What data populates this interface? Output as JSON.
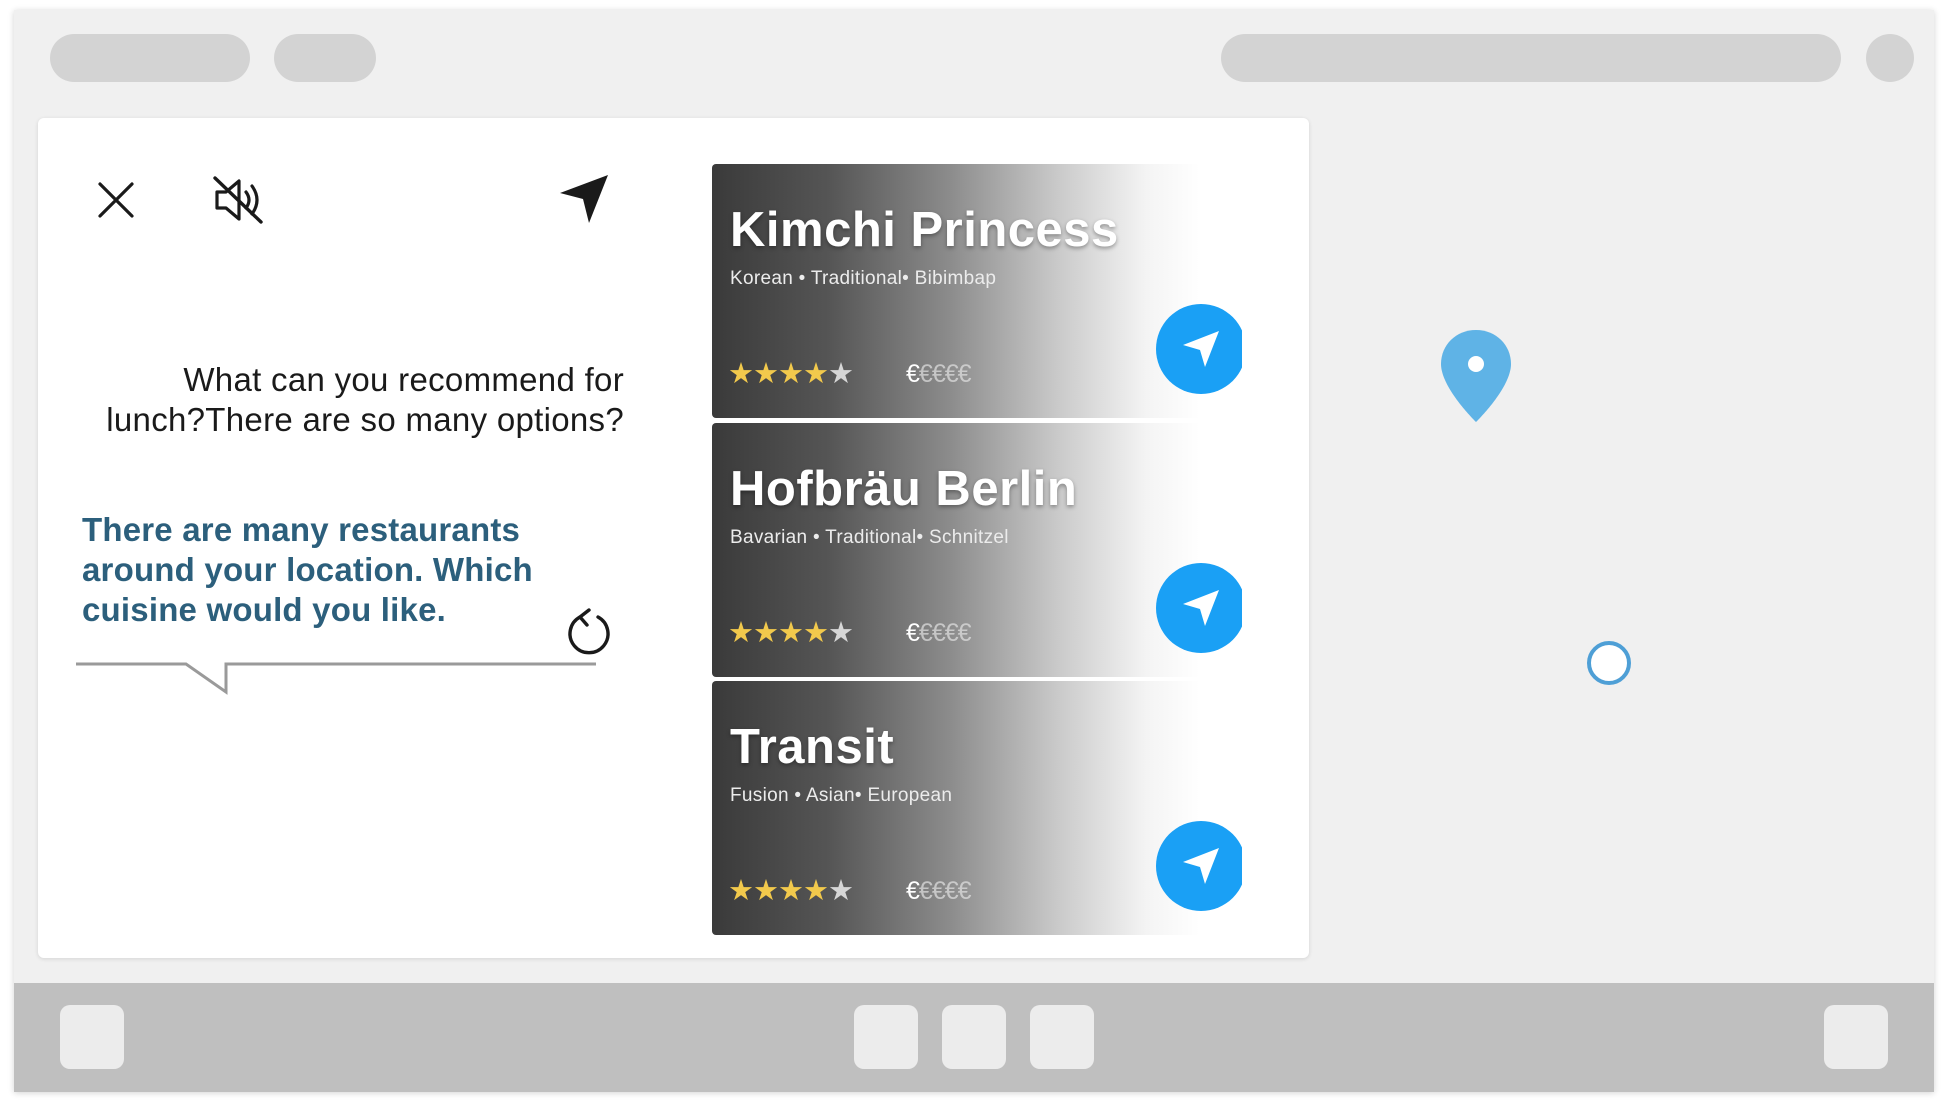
{
  "assistant": {
    "user_message": "What can you recommend for lunch?There are so many options?",
    "bot_message": "There are many restaurants around your location. Which cuisine would you like."
  },
  "icons": {
    "close": "close-icon",
    "mute": "volume-mute-icon",
    "navigate": "navigation-arrow-icon",
    "refresh": "refresh-icon",
    "map_pin": "map-pin-icon",
    "current_location": "current-location-icon"
  },
  "restaurants": [
    {
      "name": "Kimchi Princess",
      "tags": "Korean • Traditional• Bibimbap",
      "rating": 4,
      "rating_max": 5,
      "price_level": 1,
      "price_max": 5
    },
    {
      "name": "Hofbräu Berlin",
      "tags": "Bavarian • Traditional• Schnitzel",
      "rating": 4,
      "rating_max": 5,
      "price_level": 1,
      "price_max": 5
    },
    {
      "name": "Transit",
      "tags": "Fusion • Asian• European",
      "rating": 4,
      "rating_max": 5,
      "price_level": 1,
      "price_max": 5
    }
  ],
  "colors": {
    "accent": "#1aa0f5",
    "bot_text": "#2c5f7c",
    "star": "#f2c94c",
    "map_pin": "#5fb3e6"
  }
}
